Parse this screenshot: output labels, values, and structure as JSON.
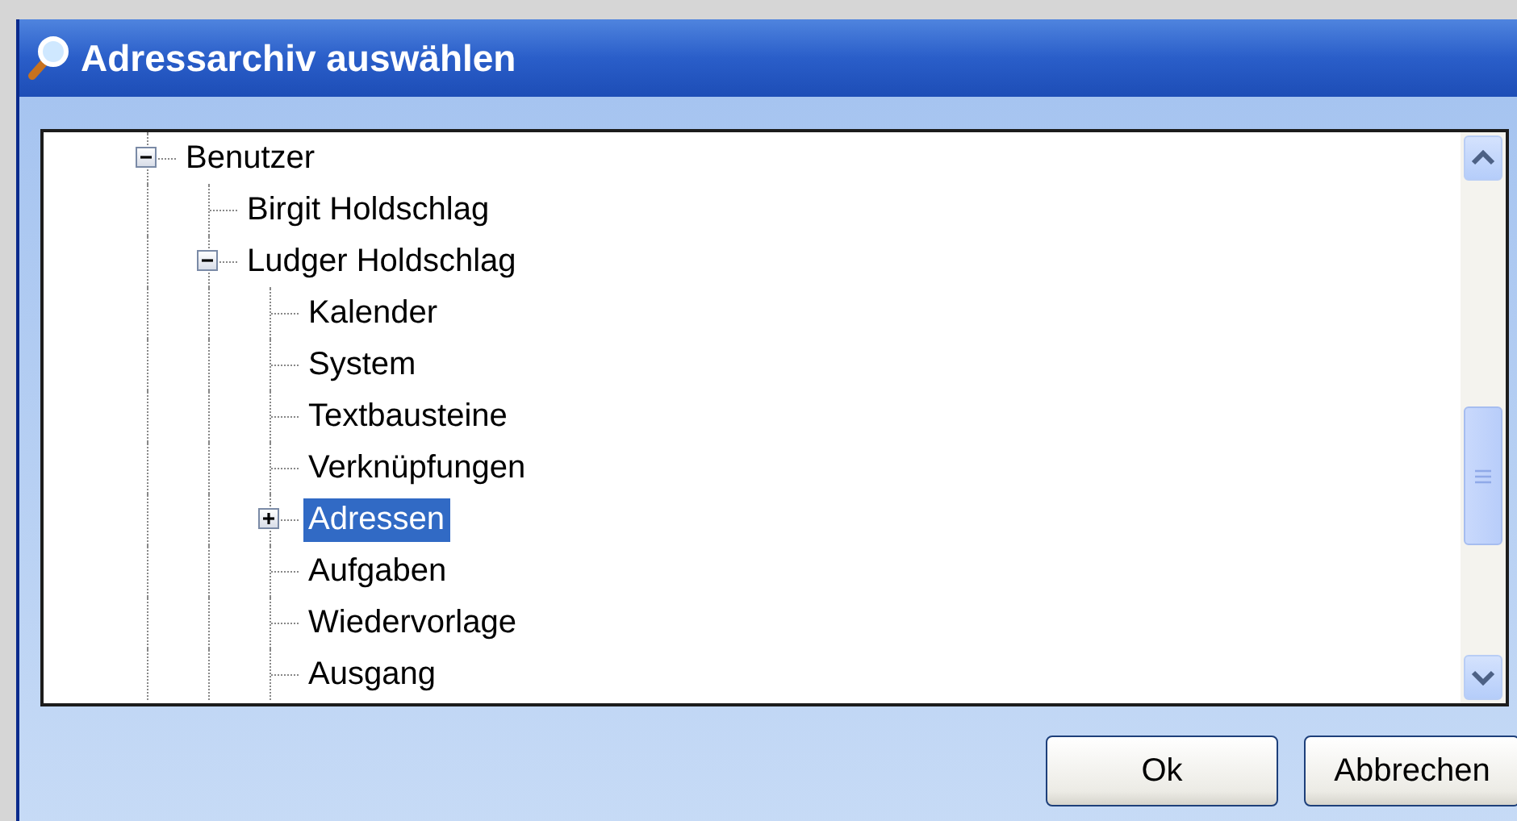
{
  "window": {
    "title": "Adressarchiv auswählen"
  },
  "tree": {
    "items": [
      {
        "label": "Benutzer",
        "expanded": true,
        "selected": false,
        "children": [
          {
            "label": "Birgit Holdschlag",
            "selected": false
          },
          {
            "label": "Ludger Holdschlag",
            "expanded": true,
            "selected": false,
            "children": [
              {
                "label": "Kalender",
                "selected": false
              },
              {
                "label": "System",
                "selected": false
              },
              {
                "label": "Textbausteine",
                "selected": false
              },
              {
                "label": "Verknüpfungen",
                "selected": false
              },
              {
                "label": "Adressen",
                "expanded": false,
                "selected": true
              },
              {
                "label": "Aufgaben",
                "selected": false
              },
              {
                "label": "Wiedervorlage",
                "selected": false
              },
              {
                "label": "Ausgang",
                "selected": false
              }
            ]
          }
        ]
      }
    ]
  },
  "buttons": [
    "Ok",
    "Abbrechen"
  ]
}
